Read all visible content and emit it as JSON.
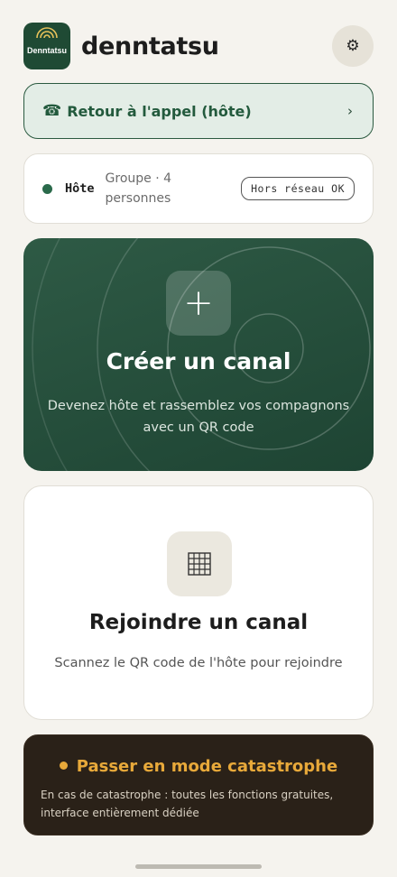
{
  "header": {
    "logo_text": "Denntatsu",
    "app_name": "denntatsu",
    "settings_icon": "gear-icon"
  },
  "return_call": {
    "icon": "phone-icon",
    "label": "Retour à l'appel (hôte)",
    "chevron": "›"
  },
  "status": {
    "role": "Hôte",
    "group": "Groupe · 4 personnes",
    "network_badge": "Hors réseau OK",
    "dot_color": "#2a6a4b"
  },
  "create": {
    "icon": "plus-icon",
    "title": "Créer un canal",
    "subtitle": "Devenez hôte et rassemblez vos compagnons avec un QR code"
  },
  "join": {
    "icon": "grid-icon",
    "title": "Rejoindre un canal",
    "subtitle": "Scannez le QR code de l'hôte pour rejoindre"
  },
  "catastrophe": {
    "title": "Passer en mode catastrophe",
    "subtitle": "En cas de catastrophe : toutes les fonctions gratuites, interface entièrement dédiée",
    "accent": "#e8a93a"
  },
  "colors": {
    "brand_green": "#1f4a34",
    "background": "#f5f3ee"
  }
}
